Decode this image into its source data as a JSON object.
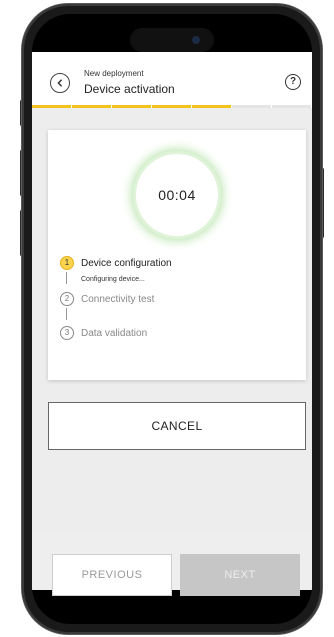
{
  "header": {
    "supertitle": "New deployment",
    "title": "Device activation",
    "help_symbol": "?",
    "progress_done": 5,
    "progress_total": 7
  },
  "timer": {
    "value": "00:04"
  },
  "steps": [
    {
      "number": "1",
      "label": "Device configuration",
      "status": "Configuring device...",
      "active": true
    },
    {
      "number": "2",
      "label": "Connectivity test",
      "active": false
    },
    {
      "number": "3",
      "label": "Data validation",
      "active": false
    }
  ],
  "actions": {
    "cancel_label": "CANCEL"
  },
  "footer": {
    "previous_label": "PREVIOUS",
    "next_label": "NEXT"
  },
  "colors": {
    "accent_yellow": "#f3c21b",
    "timer_glow": "#b9e4ad",
    "disabled_button": "#c6c6c6"
  },
  "icons": {
    "back": "chevron-left-icon",
    "help": "help-circle-icon"
  }
}
